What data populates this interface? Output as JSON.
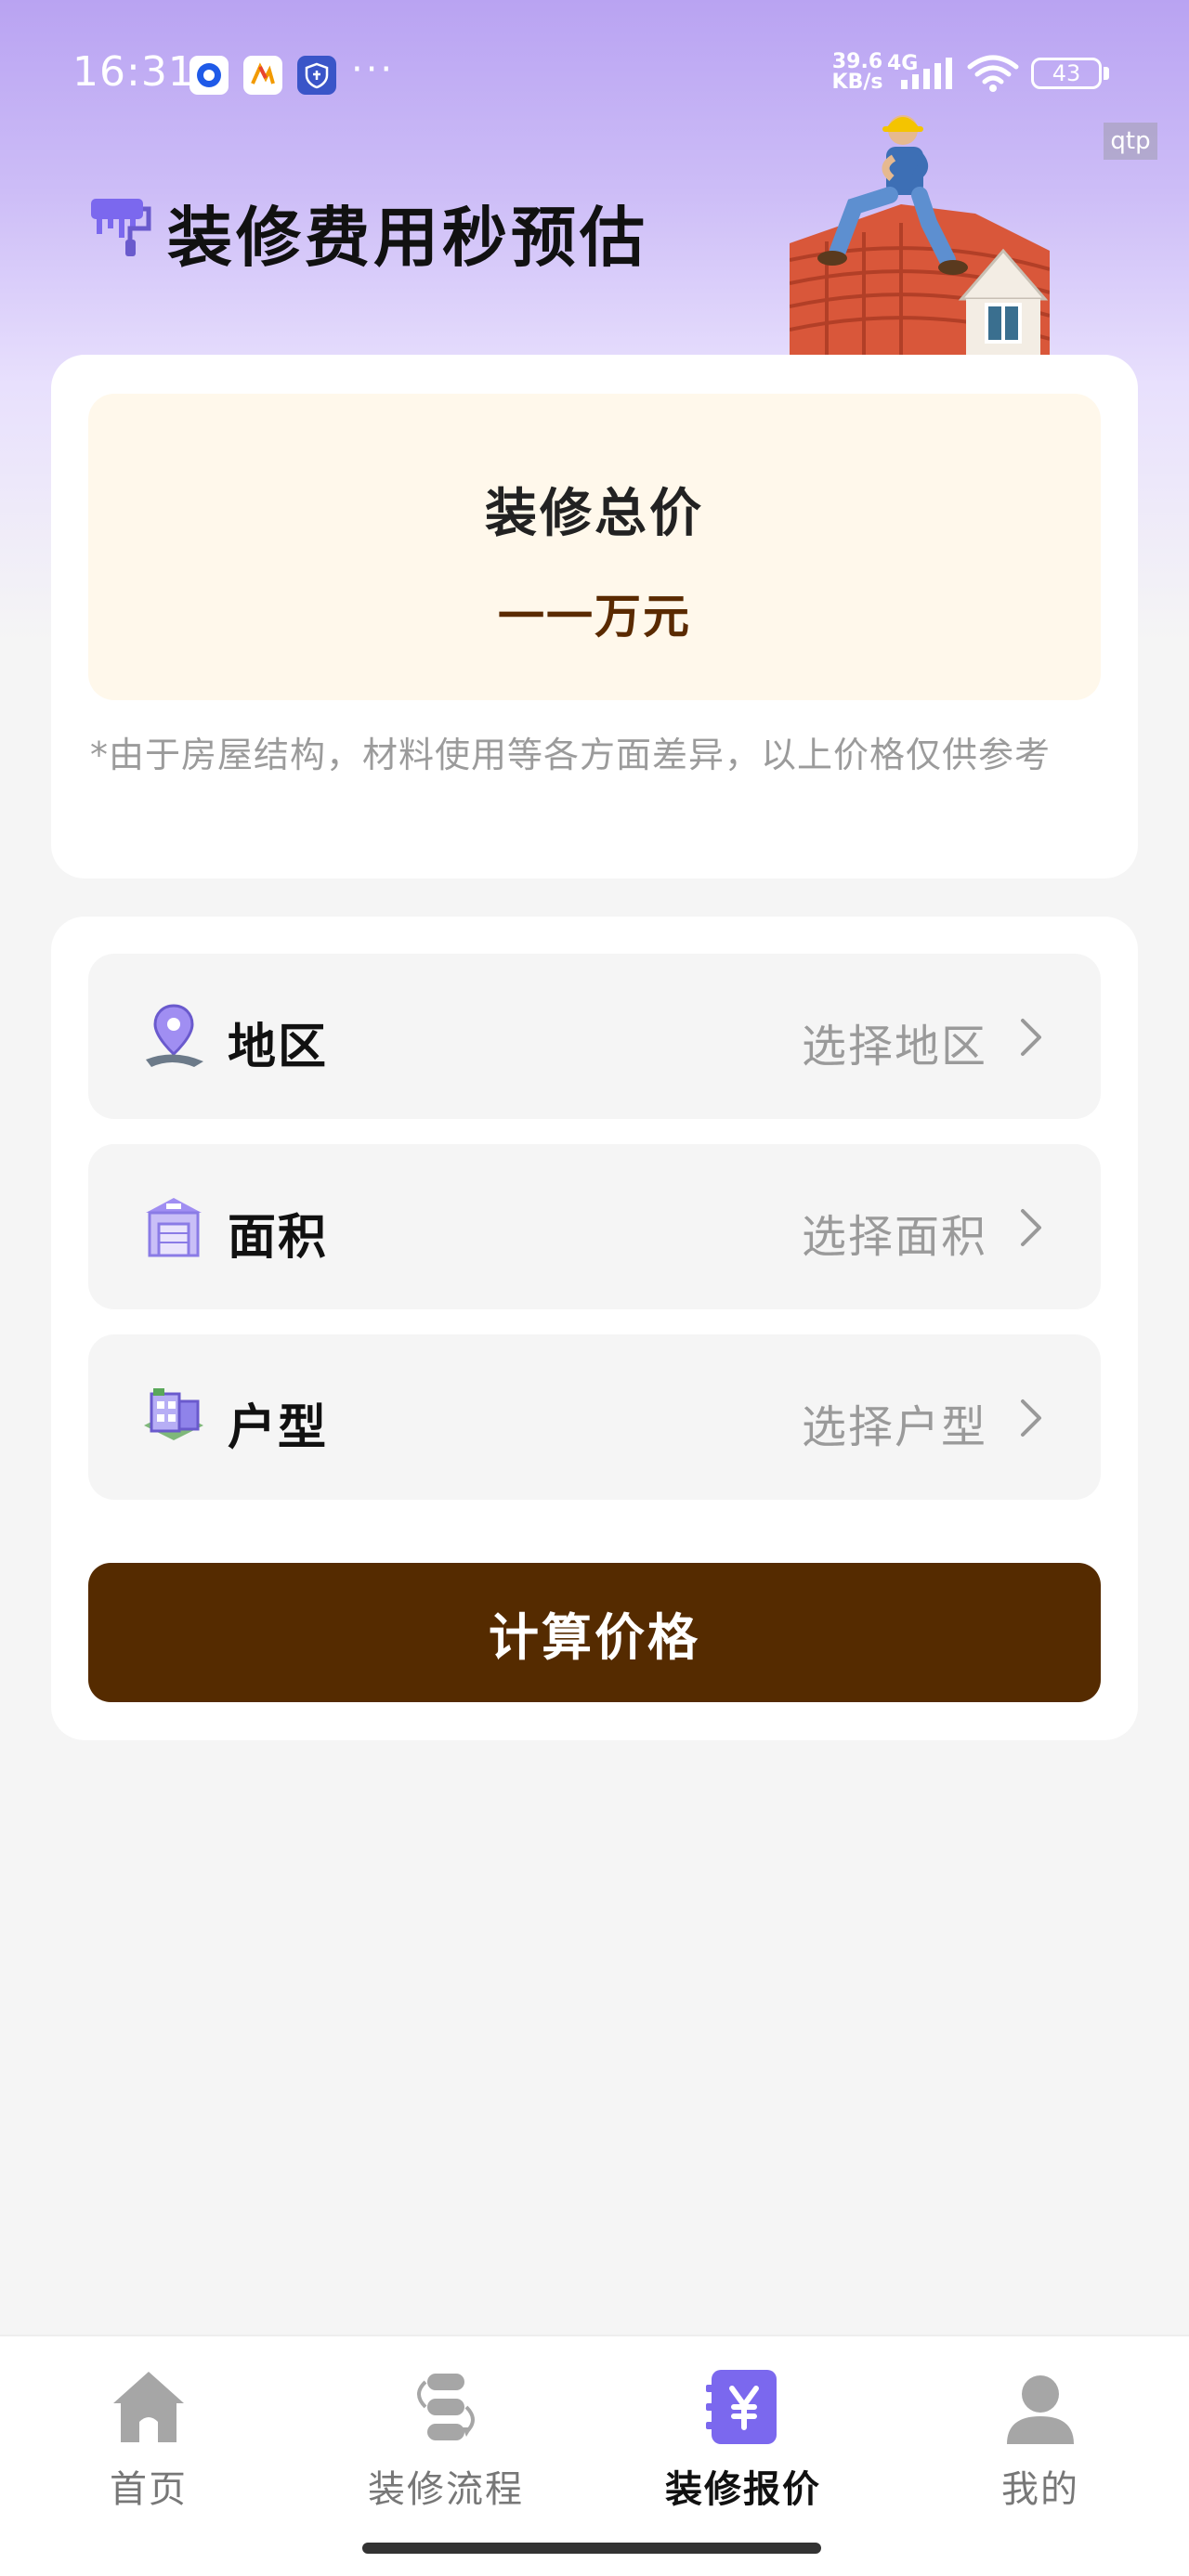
{
  "status_bar": {
    "time": "16:31",
    "net_speed_top": "39.6",
    "net_speed_bottom": "KB/s",
    "net_type": "4G",
    "battery": "43",
    "overflow": "···"
  },
  "debug_tag": "qtp",
  "header": {
    "title": "装修费用秒预估"
  },
  "total_card": {
    "title": "装修总价",
    "value": "一一万元",
    "disclaimer": "*由于房屋结构，材料使用等各方面差异，以上价格仅供参考"
  },
  "form": {
    "rows": [
      {
        "label": "地区",
        "value": "选择地区",
        "icon": "location-pin-icon"
      },
      {
        "label": "面积",
        "value": "选择面积",
        "icon": "building-icon"
      },
      {
        "label": "户型",
        "value": "选择户型",
        "icon": "house-layout-icon"
      }
    ],
    "submit_label": "计算价格"
  },
  "bottom_nav": {
    "items": [
      {
        "label": "首页",
        "icon": "home-icon",
        "active": false
      },
      {
        "label": "装修流程",
        "icon": "process-flow-icon",
        "active": false
      },
      {
        "label": "装修报价",
        "icon": "yen-quote-icon",
        "active": true
      },
      {
        "label": "我的",
        "icon": "user-icon",
        "active": false
      }
    ]
  },
  "colors": {
    "header_gradient_top": "#b9a3f2",
    "accent_purple": "#7b68ee",
    "price_brown": "#5a2a00",
    "button_brown": "#552b00",
    "total_box_bg": "#fff8eb"
  }
}
